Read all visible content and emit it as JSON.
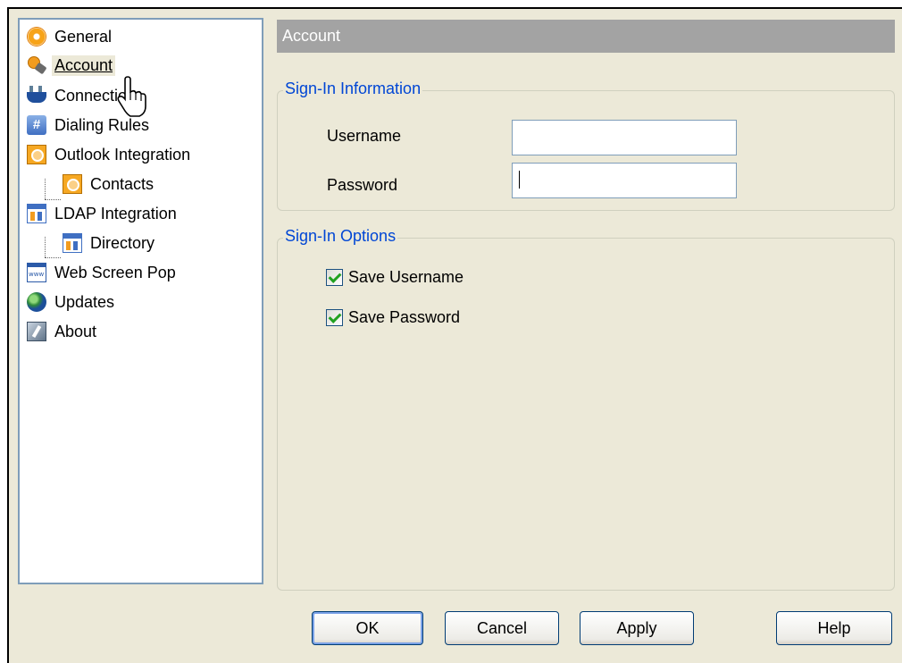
{
  "tree": {
    "items": [
      {
        "label": "General",
        "icon": "gear-icon"
      },
      {
        "label": "Account",
        "icon": "key-icon",
        "selected": true
      },
      {
        "label": "Connection",
        "icon": "plug-icon"
      },
      {
        "label": "Dialing Rules",
        "icon": "hash-icon"
      },
      {
        "label": "Outlook Integration",
        "icon": "clock-icon"
      },
      {
        "label": "Contacts",
        "icon": "clock-icon"
      },
      {
        "label": "LDAP Integration",
        "icon": "directory-icon"
      },
      {
        "label": "Directory",
        "icon": "directory-icon"
      },
      {
        "label": "Web Screen Pop",
        "icon": "web-icon"
      },
      {
        "label": "Updates",
        "icon": "globe-icon"
      },
      {
        "label": "About",
        "icon": "about-icon"
      }
    ]
  },
  "panel": {
    "header": "Account",
    "signin_info": {
      "title": "Sign-In Information",
      "username_label": "Username",
      "username_value": "",
      "password_label": "Password",
      "password_value": ""
    },
    "signin_options": {
      "title": "Sign-In Options",
      "save_username_label": "Save Username",
      "save_username_checked": true,
      "save_password_label": "Save Password",
      "save_password_checked": true
    }
  },
  "buttons": {
    "ok": "OK",
    "cancel": "Cancel",
    "apply": "Apply",
    "help": "Help"
  }
}
